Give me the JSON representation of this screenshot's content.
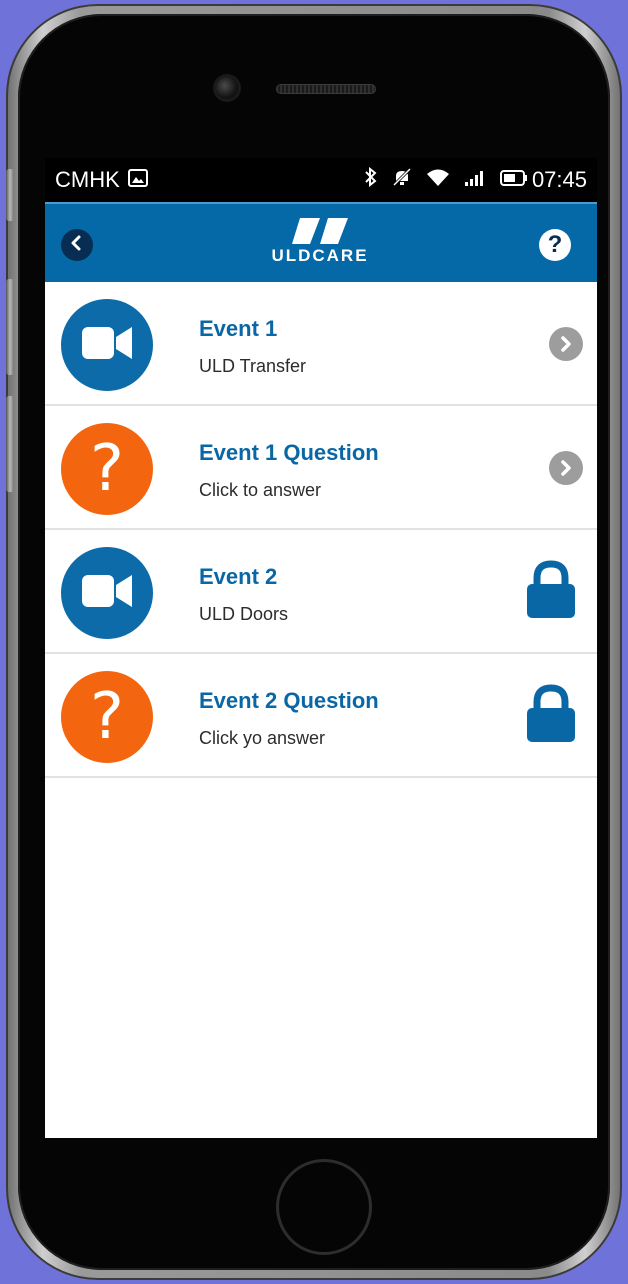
{
  "status_bar": {
    "carrier": "CMHK",
    "time": "07:45",
    "icons": [
      "image-icon",
      "bluetooth-icon",
      "mute-icon",
      "wifi-icon",
      "signal-icon",
      "battery-icon"
    ]
  },
  "app_bar": {
    "back_icon": "chevron-left-icon",
    "logo_text": "ULDCARE",
    "help_icon": "question-icon"
  },
  "events": [
    {
      "title": "Event 1",
      "subtitle": "ULD Transfer",
      "type": "video",
      "status": "available"
    },
    {
      "title": "Event 1 Question",
      "subtitle": "Click to answer",
      "type": "question",
      "status": "available"
    },
    {
      "title": "Event 2",
      "subtitle": "ULD Doors",
      "type": "video",
      "status": "locked"
    },
    {
      "title": "Event 2 Question",
      "subtitle": "Click yo answer",
      "type": "question",
      "status": "locked"
    }
  ],
  "colors": {
    "brand_blue": "#0569a8",
    "title_blue": "#0a67a6",
    "question_orange": "#f3660f",
    "chevron_gray": "#9d9d9d",
    "background": "#6f72d8"
  }
}
